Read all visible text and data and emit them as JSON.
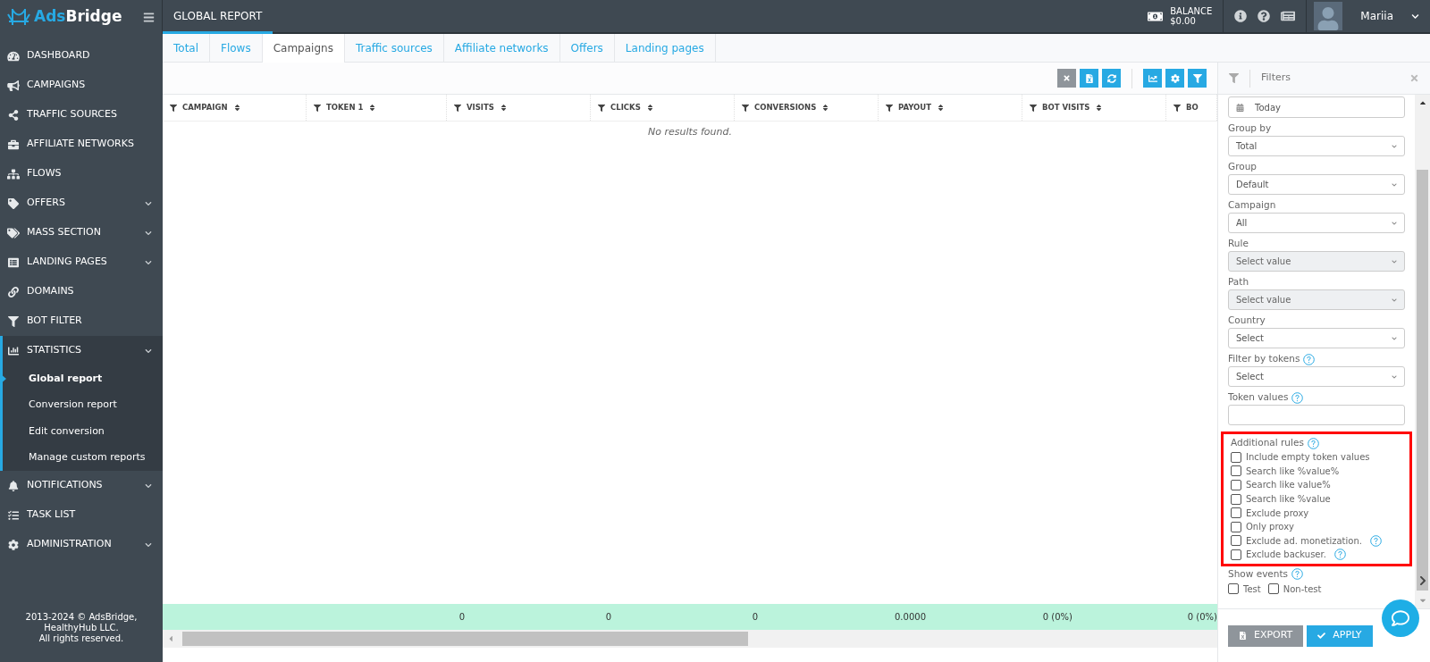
{
  "logo": {
    "part_1": "Ads",
    "part_2": "Bridge"
  },
  "header": {
    "title": "GLOBAL REPORT",
    "balance_label": "BALANCE",
    "balance_value": "$0.00",
    "user": "Mariia"
  },
  "sidebar": {
    "items": [
      {
        "label": "DASHBOARD",
        "expandable": false,
        "expanded": false
      },
      {
        "label": "CAMPAIGNS",
        "expandable": false,
        "expanded": false
      },
      {
        "label": "TRAFFIC SOURCES",
        "expandable": false,
        "expanded": false
      },
      {
        "label": "AFFILIATE NETWORKS",
        "expandable": false,
        "expanded": false
      },
      {
        "label": "FLOWS",
        "expandable": false,
        "expanded": false
      },
      {
        "label": "OFFERS",
        "expandable": true,
        "expanded": false
      },
      {
        "label": "MASS SECTION",
        "expandable": true,
        "expanded": false
      },
      {
        "label": "LANDING PAGES",
        "expandable": true,
        "expanded": false
      },
      {
        "label": "DOMAINS",
        "expandable": false,
        "expanded": false
      },
      {
        "label": "BOT FILTER",
        "expandable": false,
        "expanded": false
      },
      {
        "label": "STATISTICS",
        "expandable": true,
        "expanded": true,
        "children": [
          {
            "label": "Global report",
            "selected": true
          },
          {
            "label": "Conversion report",
            "selected": false
          },
          {
            "label": "Edit conversion",
            "selected": false
          },
          {
            "label": "Manage custom reports",
            "selected": false
          }
        ]
      },
      {
        "label": "NOTIFICATIONS",
        "expandable": true,
        "expanded": false
      },
      {
        "label": "TASK LIST",
        "expandable": false,
        "expanded": false
      },
      {
        "label": "ADMINISTRATION",
        "expandable": true,
        "expanded": false
      }
    ],
    "copyright": [
      "2013-2024 © AdsBridge,",
      "HealthyHub LLC.",
      "All rights reserved."
    ]
  },
  "tabs": [
    {
      "label": "Total",
      "selected": false
    },
    {
      "label": "Flows",
      "selected": false
    },
    {
      "label": "Campaigns",
      "selected": true
    },
    {
      "label": "Traffic sources",
      "selected": false
    },
    {
      "label": "Affiliate networks",
      "selected": false
    },
    {
      "label": "Offers",
      "selected": false
    },
    {
      "label": "Landing pages",
      "selected": false
    }
  ],
  "table": {
    "columns": [
      "CAMPAIGN",
      "TOKEN 1",
      "VISITS",
      "CLICKS",
      "CONVERSIONS",
      "PAYOUT",
      "BOT VISITS",
      "BO"
    ],
    "empty_message": "No results found.",
    "totals": [
      "0",
      "0",
      "0",
      "0.0000",
      "0 (0%)",
      "0 (0%)"
    ]
  },
  "filters": {
    "title": "Filters",
    "date": "Today",
    "fields": [
      {
        "label": "Group by",
        "kind": "select",
        "value": "Total",
        "disabled": false,
        "help": false
      },
      {
        "label": "Group",
        "kind": "select",
        "value": "Default",
        "disabled": false,
        "help": false
      },
      {
        "label": "Campaign",
        "kind": "select",
        "value": "All",
        "disabled": false,
        "help": false
      },
      {
        "label": "Rule",
        "kind": "select",
        "value": "Select value",
        "disabled": true,
        "help": false
      },
      {
        "label": "Path",
        "kind": "select",
        "value": "Select value",
        "disabled": true,
        "help": false
      },
      {
        "label": "Country",
        "kind": "select",
        "value": "Select",
        "disabled": false,
        "help": false
      },
      {
        "label": "Filter by tokens",
        "kind": "select",
        "value": "Select",
        "disabled": false,
        "help": true
      },
      {
        "label": "Token values",
        "kind": "input",
        "disabled": false,
        "help": true
      }
    ],
    "additional_rules": {
      "label": "Additional rules",
      "highlighted": true,
      "options": [
        {
          "label": "Include empty token values",
          "checked": false,
          "help": false
        },
        {
          "label": "Search like %value%",
          "checked": false,
          "help": false
        },
        {
          "label": "Search like value%",
          "checked": false,
          "help": false
        },
        {
          "label": "Search like %value",
          "checked": false,
          "help": false
        },
        {
          "label": "Exclude proxy",
          "checked": false,
          "help": false
        },
        {
          "label": "Only proxy",
          "checked": false,
          "help": false
        },
        {
          "label": "Exclude ad. monetization.",
          "checked": false,
          "help": true
        },
        {
          "label": "Exclude backuser.",
          "checked": false,
          "help": true
        }
      ]
    },
    "show_events": {
      "label": "Show events",
      "options": [
        {
          "label": "Test",
          "checked": false
        },
        {
          "label": "Non-test",
          "checked": false
        }
      ]
    },
    "buttons": [
      {
        "label": "EXPORT",
        "kind": "secondary"
      },
      {
        "label": "APPLY",
        "kind": "primary"
      }
    ]
  }
}
